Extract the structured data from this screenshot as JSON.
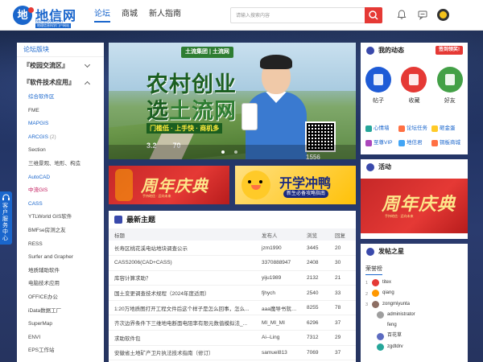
{
  "header": {
    "logo_title": "地信网",
    "logo_domain": "bbs.3s001.com",
    "logo_slogan": "地理信息科学门户网站",
    "nav": [
      "论坛",
      "商城",
      "新人指南"
    ],
    "search_placeholder": "请输入搜索内容",
    "colors": {
      "brand": "#1a66cc",
      "accent": "#e53935"
    }
  },
  "sidebar": {
    "title": "论坛版块",
    "categories": [
      {
        "label": "『校园交流区』",
        "expanded": false
      },
      {
        "label": "『软件技术应用』",
        "expanded": true
      }
    ],
    "items": [
      {
        "label": "综合软件区"
      },
      {
        "label": "FME"
      },
      {
        "label": "MAPGIS"
      },
      {
        "label": "ARCGIS",
        "count": "(2)"
      },
      {
        "label": "Section"
      },
      {
        "label": "三维景观、地形、构造"
      },
      {
        "label": "AutoCAD"
      },
      {
        "label": "中流GIS"
      },
      {
        "label": "CASS"
      },
      {
        "label": "YTLWorld GIS软件"
      },
      {
        "label": "BMFse房测之友"
      },
      {
        "label": "RESS"
      },
      {
        "label": "Surfer and Grapher"
      },
      {
        "label": "地质辅助软件"
      },
      {
        "label": "电脑技术应用"
      },
      {
        "label": "OFFICE办公"
      },
      {
        "label": "iData数据工厂"
      },
      {
        "label": "SuperMap"
      },
      {
        "label": "ENVI"
      },
      {
        "label": "EPS工作站"
      }
    ]
  },
  "service_tab": {
    "label": "客户服务中心"
  },
  "banner": {
    "brand": "土流集团 | 土流网",
    "title_line1": "农村创业",
    "title_line2_a": "选",
    "title_line2_b": "土流网",
    "slogan": "门槛低 · 上手快 · 商机多",
    "stats": [
      "3.2",
      "70",
      "1556"
    ],
    "slide_count": 2,
    "active_slide": 1
  },
  "promos": {
    "left": {
      "title": "周年庆典",
      "subtitle": "手持地信 · 迈向未来"
    },
    "right": {
      "title": "开学冲鸭",
      "subtitle": "新生必备攻略指南"
    }
  },
  "topics": {
    "title": "最新主题",
    "columns": [
      "标题",
      "发布人",
      "浏览",
      "回复"
    ],
    "rows": [
      {
        "title": "长寿区桃花溪电站地块调查公示",
        "author": "jzm1990",
        "views": "3445",
        "replies": "20"
      },
      {
        "title": "CASS2006(CAD+CASS)",
        "author": "3370888947",
        "views": "2408",
        "replies": "30"
      },
      {
        "title": "库容计算求助？",
        "author": "yiju1989",
        "views": "2132",
        "replies": "21"
      },
      {
        "title": "国土变更调查技术规程（2024年度适用）",
        "author": "fjhych",
        "views": "2540",
        "replies": "33"
      },
      {
        "title": "1:20万地质图打开工程文件后这个样子是怎么回事，怎么...",
        "author": "aaa魔导书就发商",
        "views": "8255",
        "replies": "78"
      },
      {
        "title": "齐次边界条件下三维地电断面电阻率有限元数值模拟法_...",
        "author": "MI_MI_MI",
        "views": "6296",
        "replies": "37"
      },
      {
        "title": "求助软件包",
        "author": "Ai--Ling",
        "views": "7312",
        "replies": "29"
      },
      {
        "title": "安徽省土地矿产卫片执法技术指南（修订）",
        "author": "samuel813",
        "views": "7069",
        "replies": "37"
      }
    ]
  },
  "dynamics": {
    "title": "我的动态",
    "checkin": "签到领奖!",
    "big": [
      {
        "label": "帖子",
        "color": "#1e5bd6"
      },
      {
        "label": "收藏",
        "color": "#e53935"
      },
      {
        "label": "好友",
        "color": "#43a047"
      }
    ],
    "links": [
      "心情墙",
      "论坛任务",
      "砸金蛋",
      "至尊VIP",
      "地信君",
      "铜板商城"
    ]
  },
  "activity": {
    "title": "活动",
    "banner_title": "周年庆典",
    "banner_sub": "手持地信 · 迈向未来"
  },
  "stars": {
    "title": "发帖之星",
    "tab": "荣誉榜",
    "list": [
      {
        "num": "1",
        "name": "titex",
        "color": "#e53935"
      },
      {
        "num": "2",
        "name": "qiang",
        "color": "#ff9800"
      },
      {
        "num": "3",
        "name": "zongmiyunta",
        "color": "#8d6e63"
      },
      {
        "num": "4",
        "name": "administrator",
        "color": "#9e9e9e"
      },
      {
        "num": "5",
        "name": "feng",
        "color": ""
      },
      {
        "num": "6",
        "name": "百花草",
        "color": "#5c6bc0"
      },
      {
        "num": "7",
        "name": "zgdtdrv",
        "color": "#26a69a"
      }
    ]
  }
}
